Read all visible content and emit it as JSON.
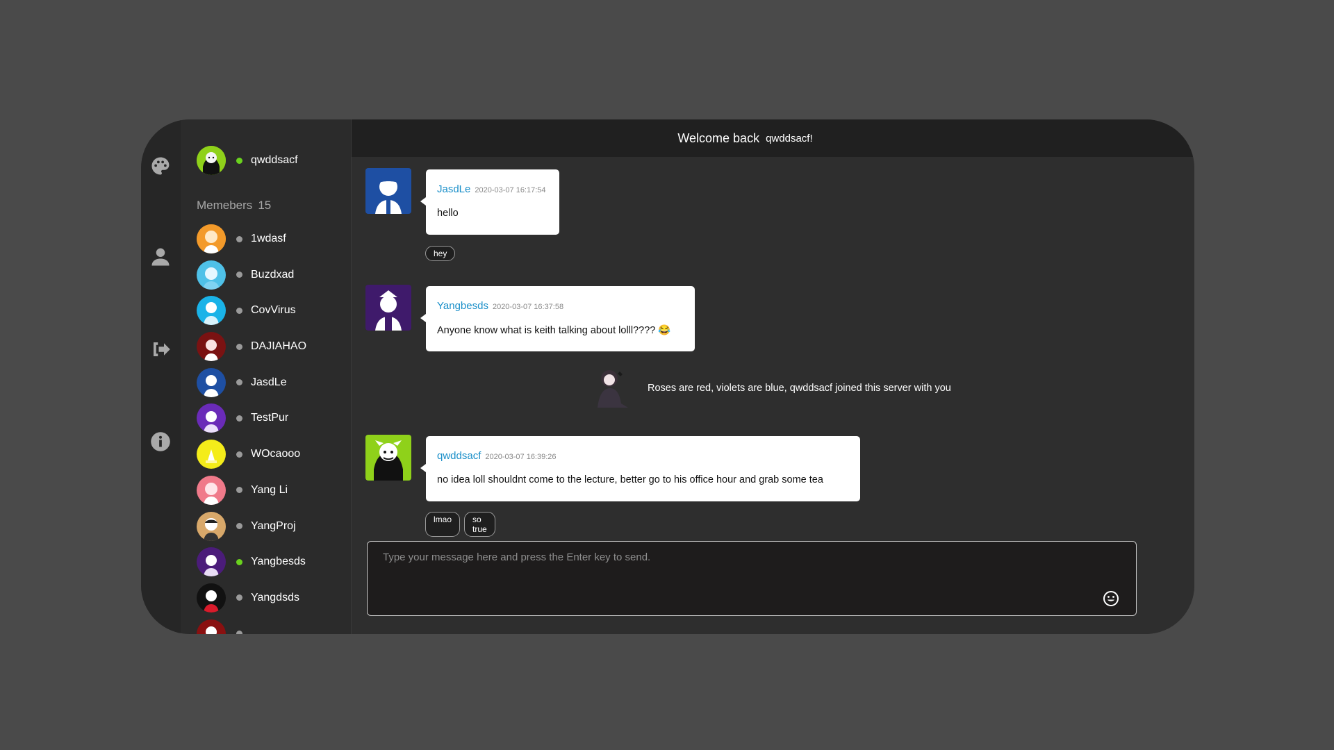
{
  "current_user": {
    "name": "qwddsacf",
    "status_color": "#6ad21e"
  },
  "members": {
    "heading": "Memebers",
    "count": "15",
    "list": [
      {
        "name": "1wdasf",
        "status_color": "#9a9a9a"
      },
      {
        "name": "Buzdxad",
        "status_color": "#9a9a9a"
      },
      {
        "name": "CovVirus",
        "status_color": "#9a9a9a"
      },
      {
        "name": "DAJIAHAO",
        "status_color": "#9a9a9a"
      },
      {
        "name": "JasdLe",
        "status_color": "#9a9a9a"
      },
      {
        "name": "TestPur",
        "status_color": "#9a9a9a"
      },
      {
        "name": "WOcaooo",
        "status_color": "#9a9a9a"
      },
      {
        "name": "Yang Li",
        "status_color": "#9a9a9a"
      },
      {
        "name": "YangProj",
        "status_color": "#9a9a9a"
      },
      {
        "name": "Yangbesds",
        "status_color": "#6ad21e"
      },
      {
        "name": "Yangdsds",
        "status_color": "#9a9a9a"
      }
    ]
  },
  "rail": {
    "icons": [
      "palette-icon",
      "user-icon",
      "sign-out-icon",
      "info-icon"
    ]
  },
  "header": {
    "welcome": "Welcome back",
    "username": "qwddsacf!"
  },
  "messages": [
    {
      "author": "JasdLe",
      "timestamp": "2020-03-07 16:17:54",
      "text": "hello",
      "reactions": [
        "hey"
      ]
    },
    {
      "author": "Yangbesds",
      "timestamp": "2020-03-07 16:37:58",
      "text": "Anyone know what is keith talking about lolll???? 😂",
      "reactions": []
    },
    {
      "author": "qwddsacf",
      "timestamp": "2020-03-07 16:39:26",
      "text": "no idea loll shouldnt come to the lecture, better go to his office hour and grab some tea",
      "reactions": [
        "lmao",
        "so true"
      ]
    }
  ],
  "system_notice": "Roses are red, violets are blue, qwddsacf joined this server with you",
  "composer": {
    "placeholder": "Type your message here and press the Enter key to send."
  },
  "colors": {
    "accent": "#1a8fc9",
    "online": "#6ad21e",
    "offline": "#9a9a9a"
  }
}
